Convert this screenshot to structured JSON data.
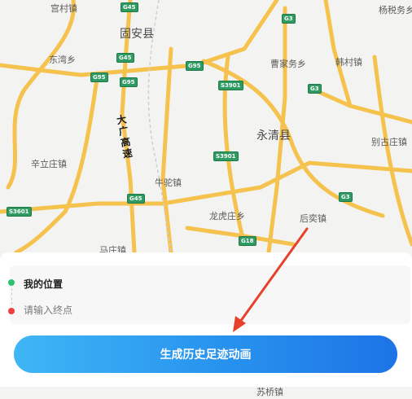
{
  "map": {
    "counties": [
      "固安县",
      "永清县"
    ],
    "places": [
      "宫村镇",
      "杨税务乡",
      "东湾乡",
      "曹家务乡",
      "韩村镇",
      "辛立庄镇",
      "别古庄镇",
      "牛驼镇",
      "后奕镇",
      "龙虎庄乡",
      "马庄镇",
      "苏桥镇"
    ],
    "roads": [
      "G45",
      "G3",
      "G95",
      "S3901",
      "S3601",
      "G18"
    ],
    "expressway": "大广高速"
  },
  "route": {
    "start_label": "我的位置",
    "end_placeholder": "请输入终点"
  },
  "action": {
    "generate_label": "生成历史足迹动画"
  },
  "colors": {
    "accent_start": "#3fb6f5",
    "accent_end": "#1d74e6",
    "start_dot": "#2bc46e",
    "end_dot": "#ec3f3f",
    "annotation_arrow": "#e8412b"
  }
}
